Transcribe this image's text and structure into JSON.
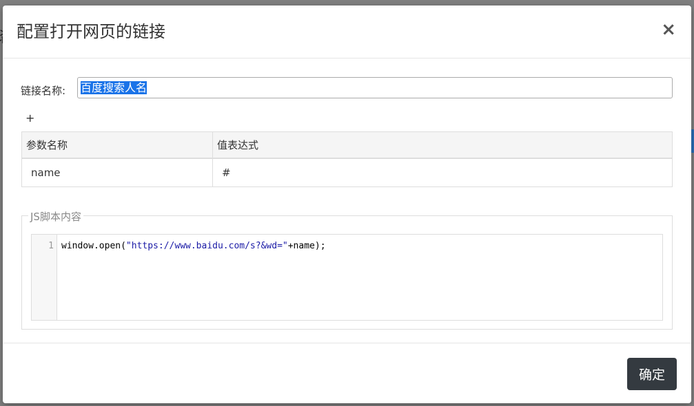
{
  "background": {
    "peek_text": "谘"
  },
  "modal": {
    "title": "配置打开网页的链接",
    "close_symbol": "×"
  },
  "link_name": {
    "label": "链接名称:",
    "value": "百度搜索人名"
  },
  "params": {
    "add_symbol": "+",
    "headers": [
      "参数名称",
      "值表达式"
    ],
    "rows": [
      {
        "name": "name",
        "expression": "#"
      }
    ]
  },
  "script": {
    "legend": "JS脚本内容",
    "line_number": "1",
    "code_prefix": "window.open(",
    "code_string": "\"https://www.baidu.com/s?&wd=\"",
    "code_suffix": "+name);"
  },
  "footer": {
    "confirm_label": "确定"
  },
  "colors": {
    "confirm_bg": "#343a40",
    "selection": "#1a73e8",
    "code_string": "#1a1aa6"
  }
}
